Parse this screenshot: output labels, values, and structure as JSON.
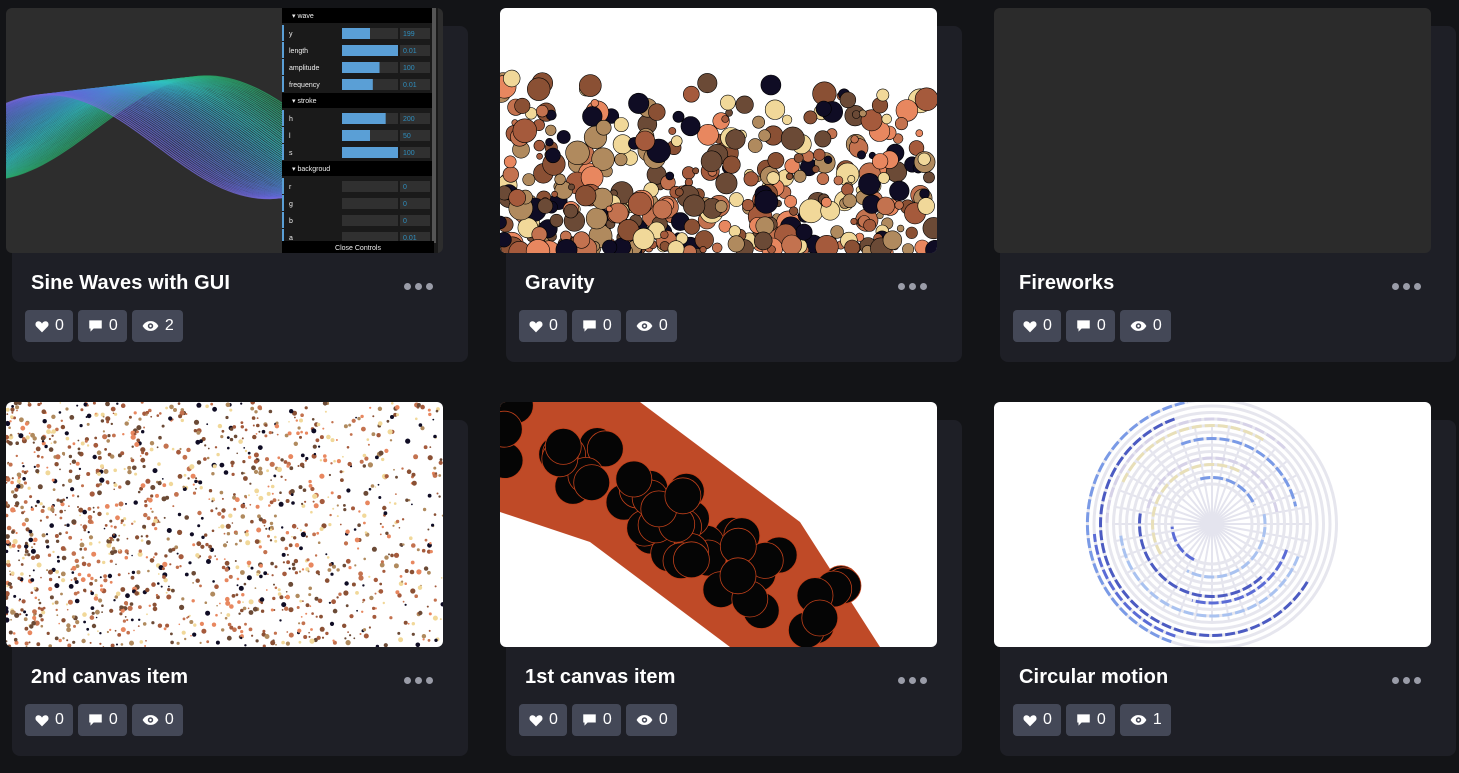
{
  "cards": [
    {
      "title": "Sine Waves with GUI",
      "likes": "0",
      "comments": "0",
      "views": "2",
      "gui": {
        "folders": [
          "wave",
          "stroke",
          "backgroud"
        ],
        "rows": [
          {
            "label": "y",
            "value": "199",
            "level": 0.5
          },
          {
            "label": "length",
            "value": "0.01",
            "level": 1.0
          },
          {
            "label": "amplitude",
            "value": "100",
            "level": 0.67
          },
          {
            "label": "frequency",
            "value": "0.01",
            "level": 0.55
          },
          {
            "label": "h",
            "value": "200",
            "level": 0.78
          },
          {
            "label": "l",
            "value": "50",
            "level": 0.5
          },
          {
            "label": "s",
            "value": "100",
            "level": 1.0
          },
          {
            "label": "r",
            "value": "0",
            "level": 0
          },
          {
            "label": "g",
            "value": "0",
            "level": 0
          },
          {
            "label": "b",
            "value": "0",
            "level": 0
          },
          {
            "label": "a",
            "value": "0.01",
            "level": 0
          }
        ],
        "close_label": "Close Controls"
      }
    },
    {
      "title": "Gravity",
      "likes": "0",
      "comments": "0",
      "views": "0"
    },
    {
      "title": "Fireworks",
      "likes": "0",
      "comments": "0",
      "views": "0"
    },
    {
      "title": "2nd canvas item",
      "likes": "0",
      "comments": "0",
      "views": "0"
    },
    {
      "title": "1st canvas item",
      "likes": "0",
      "comments": "0",
      "views": "0"
    },
    {
      "title": "Circular motion",
      "likes": "0",
      "comments": "0",
      "views": "1"
    }
  ],
  "icons": {
    "like": "heart-icon",
    "comment": "comment-icon",
    "view": "eye-icon",
    "menu": "more-options-icon"
  },
  "colors": {
    "page_bg": "#131417",
    "card_bg": "#1e1f26",
    "stat_bg": "#444857",
    "particle_palette": [
      "#0f0c24",
      "#e8875f",
      "#c3724f",
      "#8a5034",
      "#6b4a36",
      "#f1d899",
      "#b08a5e",
      "#a55a3c"
    ],
    "gui_accent": "#5a9fd6"
  }
}
